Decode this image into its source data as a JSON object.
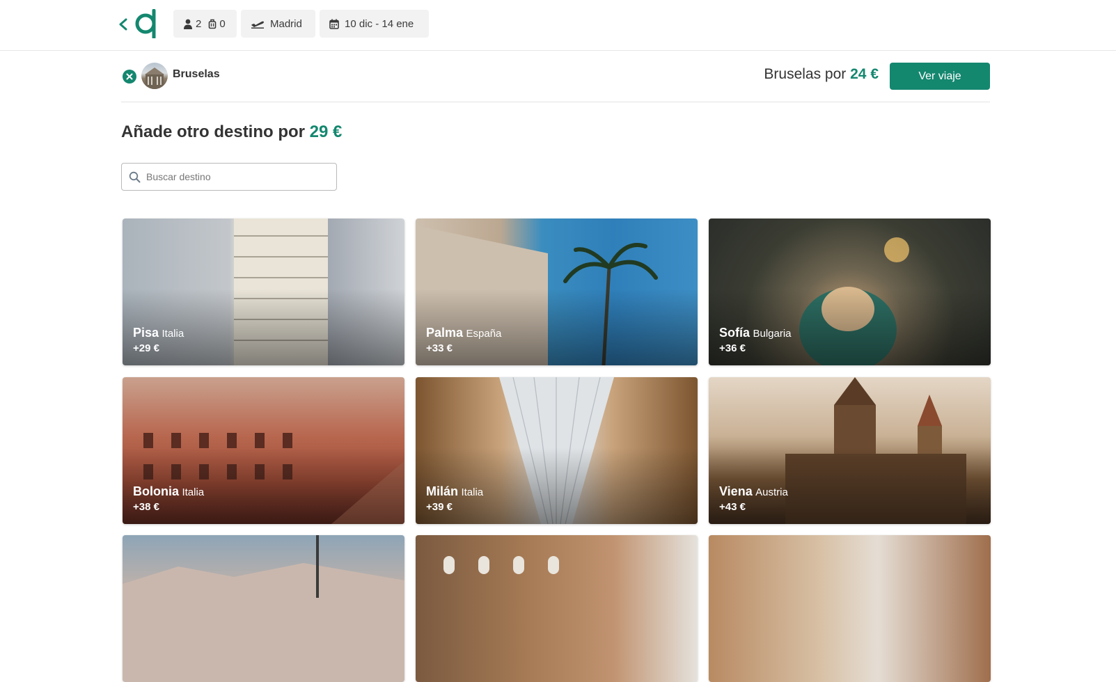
{
  "header": {
    "adults": "2",
    "bags": "0",
    "origin": "Madrid",
    "dates": "10 dic - 14 ene"
  },
  "selected": {
    "destination": "Bruselas",
    "summary_prefix": "Bruselas por",
    "summary_price": "24 €",
    "cta_label": "Ver viaje"
  },
  "add_section": {
    "heading_prefix": "Añade otro destino por",
    "heading_price": "29 €",
    "search_placeholder": "Buscar destino"
  },
  "destinations": [
    {
      "city": "Pisa",
      "country": "Italia",
      "price": "+29 €"
    },
    {
      "city": "Palma",
      "country": "España",
      "price": "+33 €"
    },
    {
      "city": "Sofía",
      "country": "Bulgaria",
      "price": "+36 €"
    },
    {
      "city": "Bolonia",
      "country": "Italia",
      "price": "+38 €"
    },
    {
      "city": "Milán",
      "country": "Italia",
      "price": "+39 €"
    },
    {
      "city": "Viena",
      "country": "Austria",
      "price": "+43 €"
    }
  ],
  "colors": {
    "brand": "#14876f",
    "chip_bg": "#f2f2f2"
  }
}
